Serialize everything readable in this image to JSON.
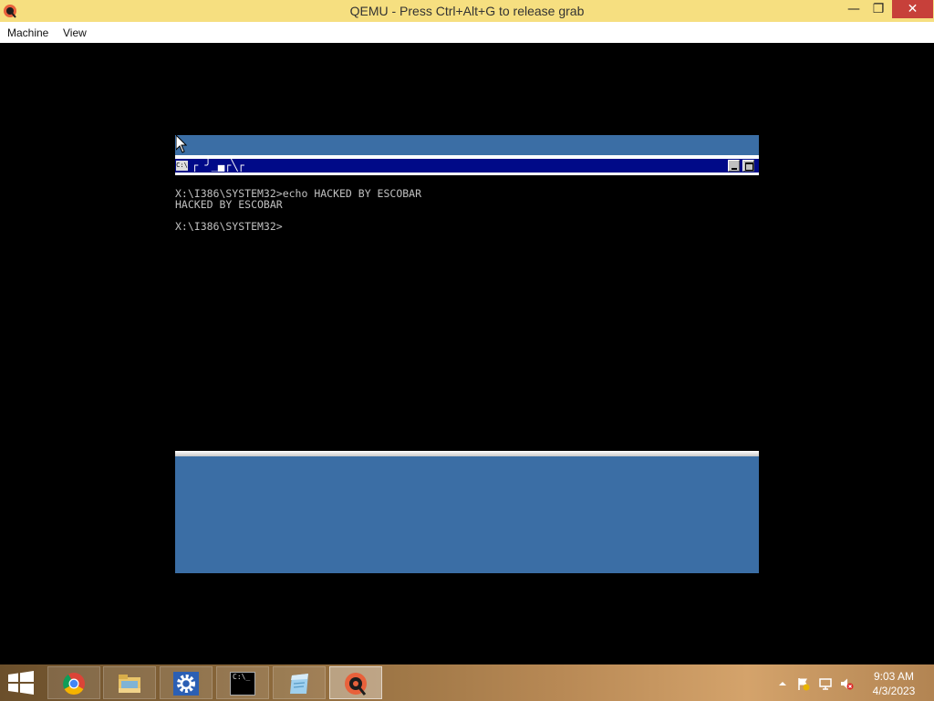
{
  "window": {
    "title": "QEMU - Press Ctrl+Alt+G to release grab",
    "controls": {
      "minimize": "—",
      "restore": "❐",
      "close": "✕"
    }
  },
  "menu": {
    "items": [
      "Machine",
      "View"
    ]
  },
  "console": {
    "icon_text": "C:\\",
    "title_glyphs": "┌ ╯_▄┌╲┌",
    "lines": [
      "X:\\I386\\SYSTEM32>echo HACKED BY ESCOBAR",
      "HACKED BY ESCOBAR",
      "",
      "X:\\I386\\SYSTEM32>"
    ]
  },
  "taskbar": {
    "apps": [
      {
        "name": "chrome-icon"
      },
      {
        "name": "file-explorer-icon"
      },
      {
        "name": "settings-icon"
      },
      {
        "name": "command-prompt-icon",
        "icon_text": "C:\\_"
      },
      {
        "name": "notepad-icon"
      },
      {
        "name": "qemu-icon",
        "active": true
      }
    ],
    "tray": {
      "icons": [
        "show-hidden-icons-icon",
        "action-center-flag-icon",
        "network-icon",
        "volume-muted-icon"
      ],
      "time": "9:03 AM",
      "date": "4/3/2023"
    }
  },
  "colors": {
    "titlebar": "#f6df80",
    "wallpaper": "#3b6ea5",
    "console_title": "#000a88",
    "close_button": "#c7403a"
  }
}
